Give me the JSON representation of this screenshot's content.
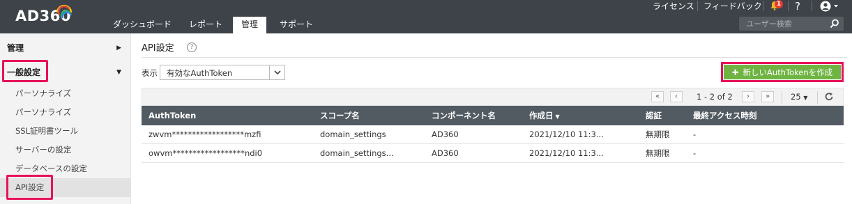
{
  "app": {
    "logo": "AD360"
  },
  "nav": {
    "tabs": [
      {
        "label": "ダッシュボード"
      },
      {
        "label": "レポート"
      },
      {
        "label": "管理"
      },
      {
        "label": "サポート"
      }
    ]
  },
  "header": {
    "license": "ライセンス",
    "feedback": "フィードバック",
    "notification_count": "1",
    "help": "?",
    "search_placeholder": "ユーザー検索"
  },
  "sidebar": {
    "section_admin": "管理",
    "section_general": "一般設定",
    "items": [
      {
        "label": "パーソナライズ"
      },
      {
        "label": "パーソナライズ"
      },
      {
        "label": "SSL証明書ツール"
      },
      {
        "label": "サーバーの設定"
      },
      {
        "label": "データベースの設定"
      },
      {
        "label": "API設定"
      }
    ]
  },
  "main": {
    "title": "API設定",
    "help": "?",
    "filter_label": "表示",
    "filter_value": "有効なAuthToken",
    "create_button": "新しいAuthTokenを作成"
  },
  "pager": {
    "text": "1 - 2 of 2",
    "page_size": "25"
  },
  "table": {
    "columns": [
      "AuthToken",
      "スコープ名",
      "コンポーネント名",
      "作成日",
      "認証",
      "最終アクセス時刻"
    ],
    "rows": [
      [
        "zwvm******************mzfi",
        "domain_settings",
        "AD360",
        "2021/12/10 11:3...",
        "無期限",
        "-"
      ],
      [
        "owvm******************ndi0",
        "domain_settings...",
        "AD360",
        "2021/12/10 11:3...",
        "無期限",
        "-"
      ]
    ]
  },
  "colors": {
    "topbar": "#3d4348",
    "accent_green": "#6fb443",
    "highlight": "#e8115b",
    "table_header": "#525b62"
  }
}
